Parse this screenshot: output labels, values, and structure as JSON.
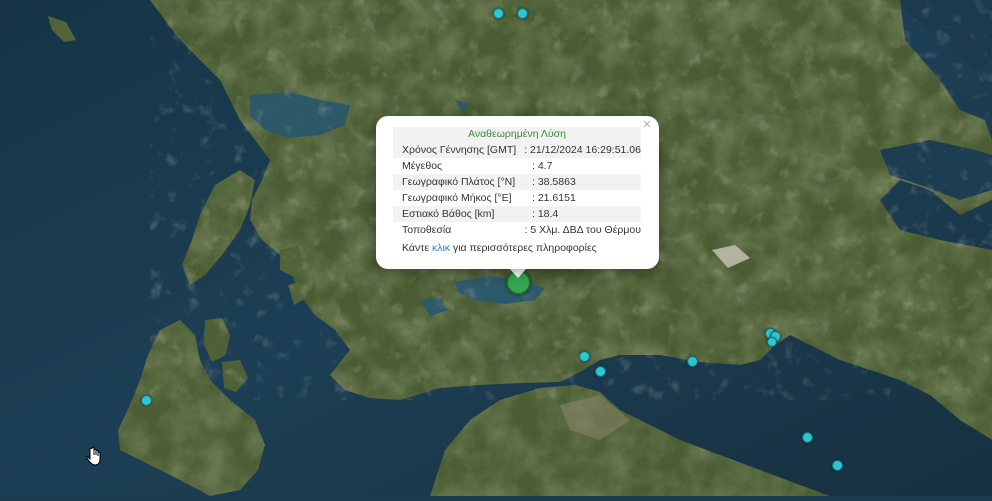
{
  "map": {
    "colors": {
      "sea_deep": "#1c3a4f",
      "sea_shallow": "#2a5870",
      "land_green": "#4c5e33",
      "land_dark": "#3a4a28",
      "land_light": "#7c7c5c",
      "lake": "#2d5a6a",
      "marker_secondary": "#2fc4d0",
      "marker_main": "#34a852"
    },
    "markers_icon": "earthquake-circle-icon"
  },
  "popup": {
    "title": "Αναθεωρημένη Λύση",
    "close_icon": "close-icon",
    "close_label": "×",
    "rows": [
      {
        "label": "Χρόνος Γέννησης [GMT]",
        "value": ": 21/12/2024 16:29:51.06"
      },
      {
        "label": "Μέγεθος",
        "value": ": 4.7"
      },
      {
        "label": "Γεωγραφικό Πλάτος [°N]",
        "value": ": 38.5863"
      },
      {
        "label": "Γεωγραφικό Μήκος [°E]",
        "value": ": 21.6151"
      },
      {
        "label": "Εστιακό Βάθος [km]",
        "value": ": 18.4"
      },
      {
        "label": "Τοποθεσία",
        "value": ": 5 Χλμ. ΔΒΔ του Θέρμου"
      }
    ],
    "more_prefix": "Κάντε",
    "more_link": "κλικ",
    "more_suffix": "για περισσότερες πληροφορίες",
    "title_color": "#3a8a3a",
    "link_color": "#2a7fd4"
  },
  "cursor_icon": "hand-pointer-icon"
}
